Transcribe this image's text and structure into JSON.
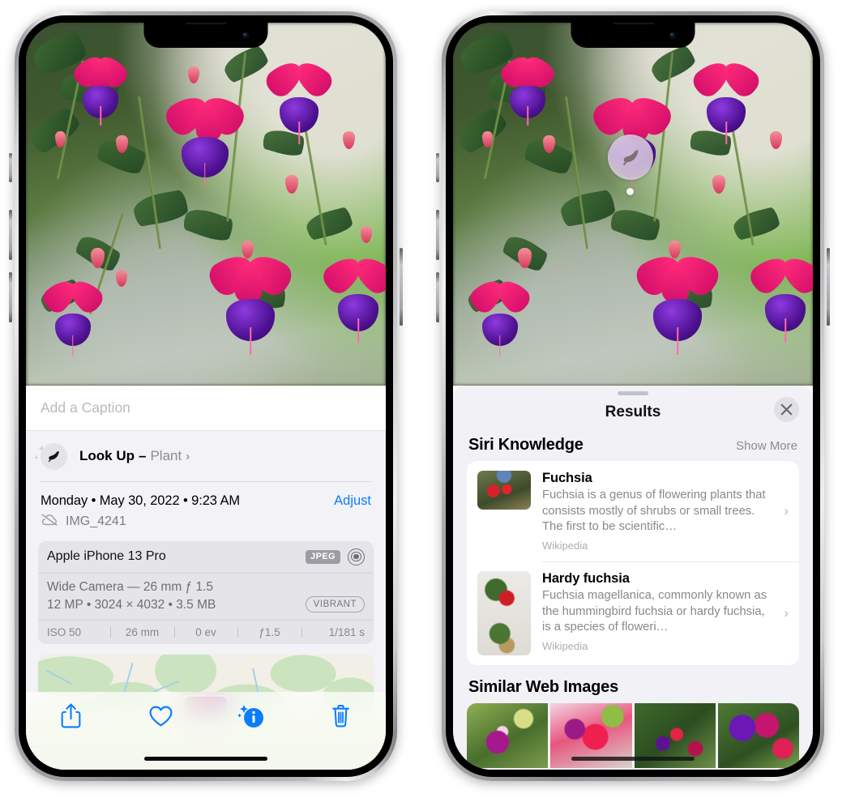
{
  "left_phone": {
    "caption_field": {
      "placeholder": "Add a Caption",
      "value": ""
    },
    "look_up": {
      "label": "Look Up",
      "dash": "–",
      "subject": "Plant",
      "chevron": "›",
      "icon": "leaf-icon"
    },
    "metadata": {
      "date_line": "Monday • May 30, 2022 • 9:23 AM",
      "adjust_label": "Adjust",
      "filename": "IMG_4241",
      "cloud_icon": "cloud-slash-icon"
    },
    "camera_card": {
      "device": "Apple iPhone 13 Pro",
      "format_badge": "JPEG",
      "lens_icon": "lens-icon",
      "lens_line": "Wide Camera — 26 mm ƒ 1.5",
      "specs_line": "12 MP • 3024 × 4032 • 3.5 MB",
      "style_badge": "VIBRANT",
      "exif": [
        "ISO 50",
        "26 mm",
        "0 ev",
        "ƒ1.5",
        "1/181 s"
      ]
    },
    "toolbar": [
      {
        "name": "share-button",
        "icon": "share-icon"
      },
      {
        "name": "favorite-button",
        "icon": "heart-icon"
      },
      {
        "name": "info-button",
        "icon": "info-sparkle-icon"
      },
      {
        "name": "delete-button",
        "icon": "trash-icon"
      }
    ],
    "accent_color": "#0a7cff"
  },
  "right_phone": {
    "visual_lookup_badge": {
      "icon": "leaf-icon"
    },
    "sheet": {
      "title": "Results",
      "close_icon": "close-icon",
      "sections": [
        {
          "title": "Siri Knowledge",
          "action": "Show More",
          "items": [
            {
              "name": "Fuchsia",
              "description": "Fuchsia is a genus of flowering plants that consists mostly of shrubs or small trees. The first to be scientific…",
              "source": "Wikipedia",
              "chevron": "›"
            },
            {
              "name": "Hardy fuchsia",
              "description": "Fuchsia magellanica, commonly known as the hummingbird fuchsia or hardy fuchsia, is a species of floweri…",
              "source": "Wikipedia",
              "chevron": "›"
            }
          ]
        },
        {
          "title": "Similar Web Images",
          "action": "",
          "thumbnails": [
            "web-image-1",
            "web-image-2",
            "web-image-3",
            "web-image-4"
          ]
        }
      ]
    }
  }
}
